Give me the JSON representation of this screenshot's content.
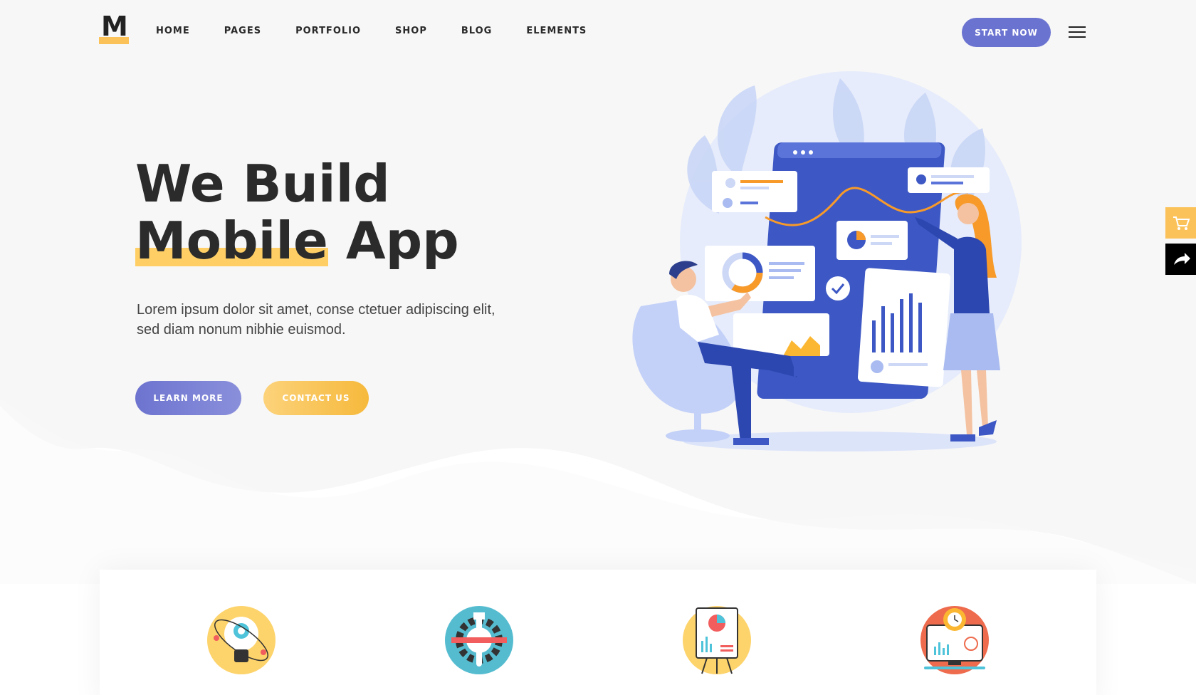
{
  "brand": {
    "logo_letter": "M"
  },
  "nav": {
    "items": [
      {
        "label": "HOME"
      },
      {
        "label": "PAGES"
      },
      {
        "label": "PORTFOLIO"
      },
      {
        "label": "SHOP"
      },
      {
        "label": "BLOG"
      },
      {
        "label": "ELEMENTS"
      }
    ],
    "cta_label": "START NOW"
  },
  "hero": {
    "title_line1": "We Build",
    "title_highlight": "Mobile",
    "title_rest": " App",
    "subtitle": "Lorem ipsum dolor sit amet, conse ctetuer adipiscing elit, sed diam nonum nibhie euismod.",
    "learn_more_label": "LEARN MORE",
    "contact_label": "CONTACT US"
  },
  "colors": {
    "page_bg": "#f7f7f7",
    "accent_purple": "#6b73d1",
    "accent_yellow": "#fbc25a",
    "highlight_yellow": "#ffcf66",
    "dark_text": "#2b2b2b",
    "illustration_blue": "#3d58c4",
    "illustration_orange": "#f79a2a"
  },
  "side_buttons": [
    {
      "icon": "cart-icon"
    },
    {
      "icon": "share-icon"
    }
  ],
  "features": [
    {
      "icon": "idea-bulb-icon"
    },
    {
      "icon": "tools-gear-icon"
    },
    {
      "icon": "presentation-board-icon"
    },
    {
      "icon": "monitor-analytics-icon"
    }
  ]
}
